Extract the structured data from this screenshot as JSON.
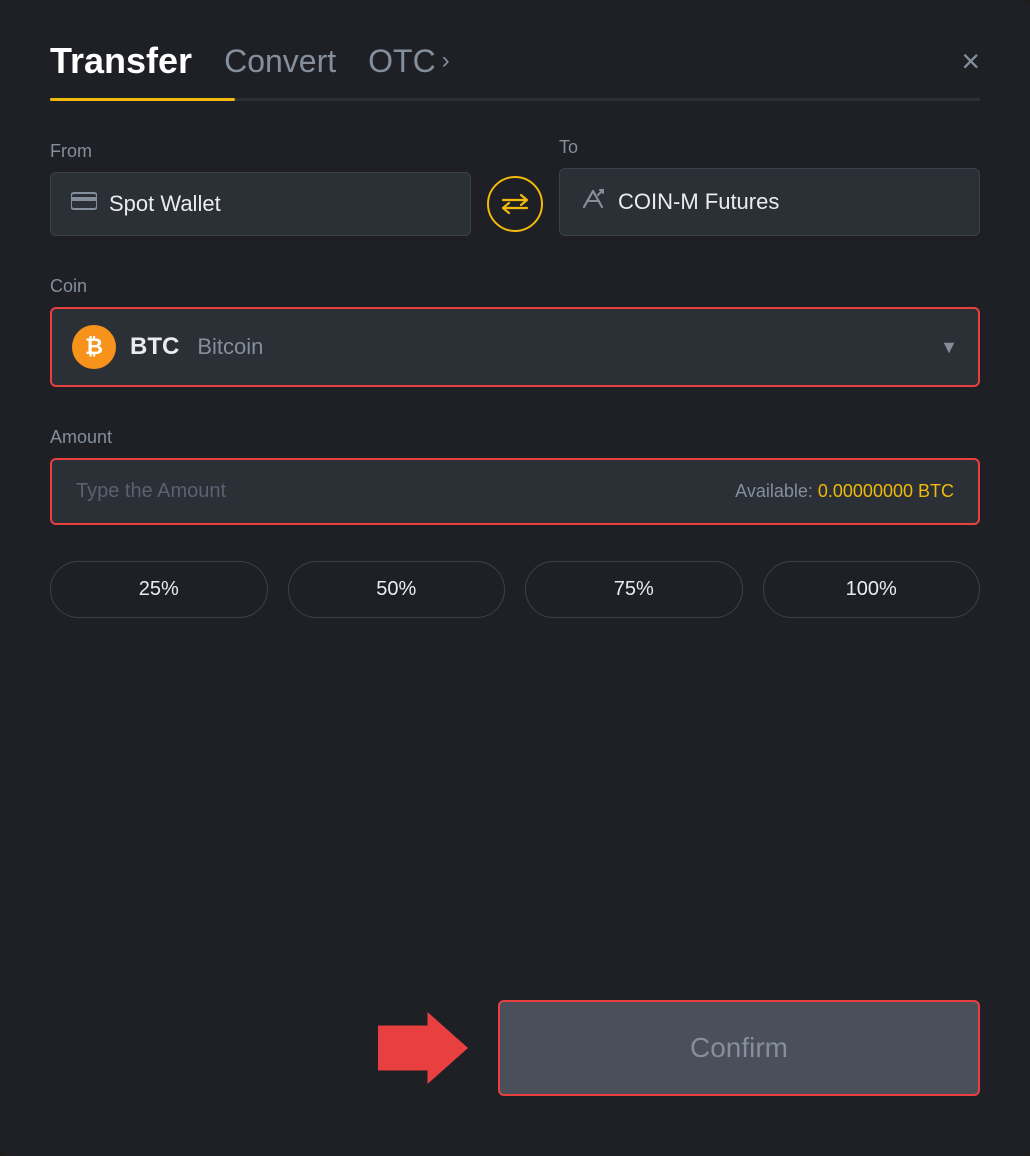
{
  "header": {
    "title": "Transfer",
    "tab_convert": "Convert",
    "tab_otc": "OTC",
    "close_label": "×"
  },
  "from_section": {
    "label": "From",
    "wallet_name": "Spot Wallet"
  },
  "to_section": {
    "label": "To",
    "wallet_name": "COIN-M Futures"
  },
  "coin_section": {
    "label": "Coin",
    "coin_symbol": "BTC",
    "coin_name": "Bitcoin"
  },
  "amount_section": {
    "label": "Amount",
    "placeholder": "Type the Amount",
    "available_label": "Available:",
    "available_value": "0.00000000 BTC"
  },
  "percentage_buttons": [
    "25%",
    "50%",
    "75%",
    "100%"
  ],
  "confirm_button": {
    "label": "Confirm"
  }
}
